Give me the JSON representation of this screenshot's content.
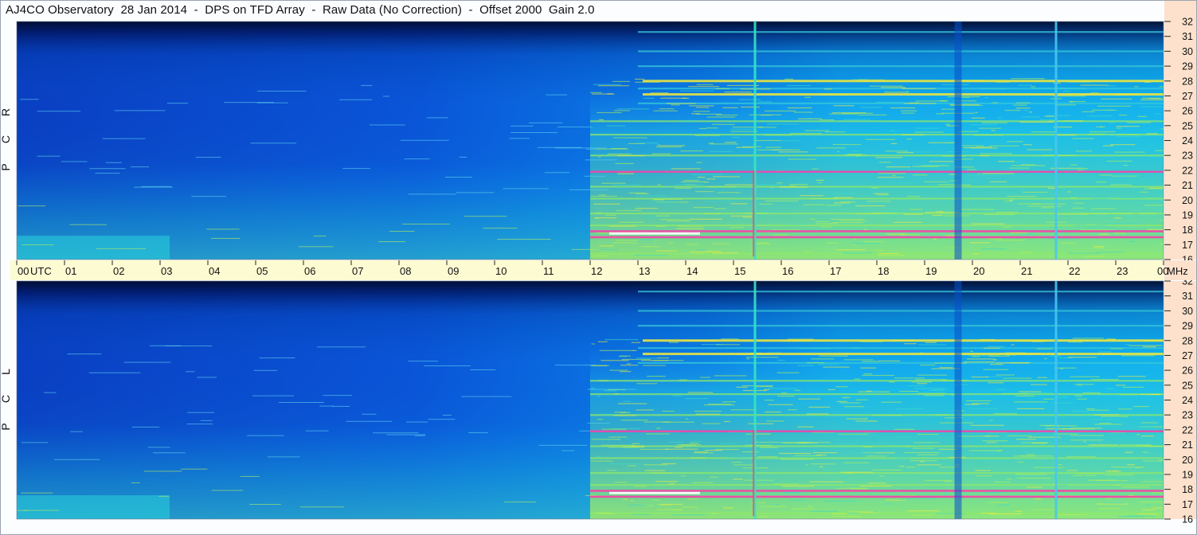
{
  "title": "AJ4CO Observatory  28 Jan 2014  -  DPS on TFD Array  -  Raw Data (No Correction)  -  Offset 2000  Gain 2.0",
  "colors": {
    "time_strip": "#fdfbd2",
    "freq_axis_bg": "#fde1cc",
    "colormap": [
      "#000a3a",
      "#0030a8",
      "#0072ea",
      "#10b8f0",
      "#30d8c8",
      "#a8f060",
      "#fff23a",
      "#ff3aa8",
      "#ffffff"
    ]
  },
  "chart_data": {
    "type": "heatmap",
    "xlabel": "UTC",
    "ylabel": "MHz",
    "x_ticks": [
      "00",
      "01",
      "02",
      "03",
      "04",
      "05",
      "06",
      "07",
      "08",
      "09",
      "10",
      "11",
      "12",
      "13",
      "14",
      "15",
      "16",
      "17",
      "18",
      "19",
      "20",
      "21",
      "22",
      "23",
      "00"
    ],
    "xlim": [
      0,
      24
    ],
    "ylim": [
      16,
      32
    ],
    "y_ticks": [
      "32",
      "31",
      "30",
      "29",
      "28",
      "27",
      "26",
      "25",
      "24",
      "23",
      "22",
      "21",
      "20",
      "19",
      "18",
      "17",
      "16"
    ],
    "panels": [
      {
        "name": "RCP",
        "letters": [
          "R",
          "C",
          "P"
        ]
      },
      {
        "name": "LCP",
        "letters": [
          "L",
          "C",
          "P"
        ]
      }
    ],
    "features": {
      "activity_onset_hours_utc": 12.0,
      "vertical_lines_hours_utc": [
        15.45,
        19.7,
        21.75
      ],
      "strong_bands_mhz": [
        17.5,
        17.9,
        21.9,
        27.1,
        28.0
      ],
      "moderate_bands_mhz": [
        16.4,
        18.3,
        19.1,
        20.1,
        20.9,
        23.0,
        24.4,
        25.3,
        26.5,
        27.5,
        29.0,
        30.0,
        31.3
      ]
    }
  }
}
